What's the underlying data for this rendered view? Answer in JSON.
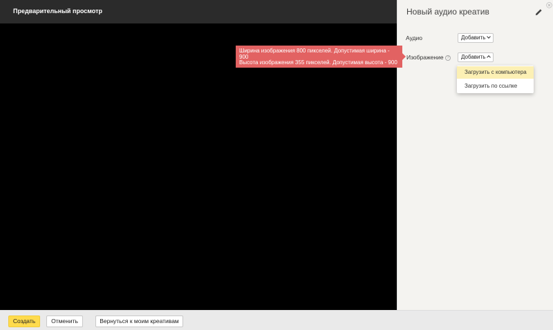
{
  "preview": {
    "title": "Предварительный просмотр"
  },
  "panel": {
    "title": "Новый аудио креатив",
    "fields": {
      "audio_label": "Аудио",
      "audio_button": "Добавить",
      "image_label": "Изображение",
      "image_help": "?",
      "image_button": "Добавить"
    },
    "dropdown": {
      "items": [
        "Загрузить с компьютера",
        "Загрузить по ссылке"
      ],
      "active_index": 0
    }
  },
  "tooltip": {
    "line1": "Ширина изображения 800 пикселей. Допустимая ширина - 900",
    "line2": "Высота изображения 355 пикселей. Допустимая высота - 900",
    "color": "#e26262"
  },
  "footer": {
    "create_label": "Создать",
    "cancel_label": "Отменить",
    "back_label": "Вернуться к моим креативам"
  },
  "colors": {
    "accent": "#ffdb4d",
    "preview_bg": "#000000",
    "header_bg": "#2b2b2b",
    "dropdown_active": "#fcf0b4"
  },
  "icons": [
    "pencil-icon",
    "close-icon",
    "help-icon",
    "chevron-down-icon",
    "chevron-up-icon"
  ]
}
